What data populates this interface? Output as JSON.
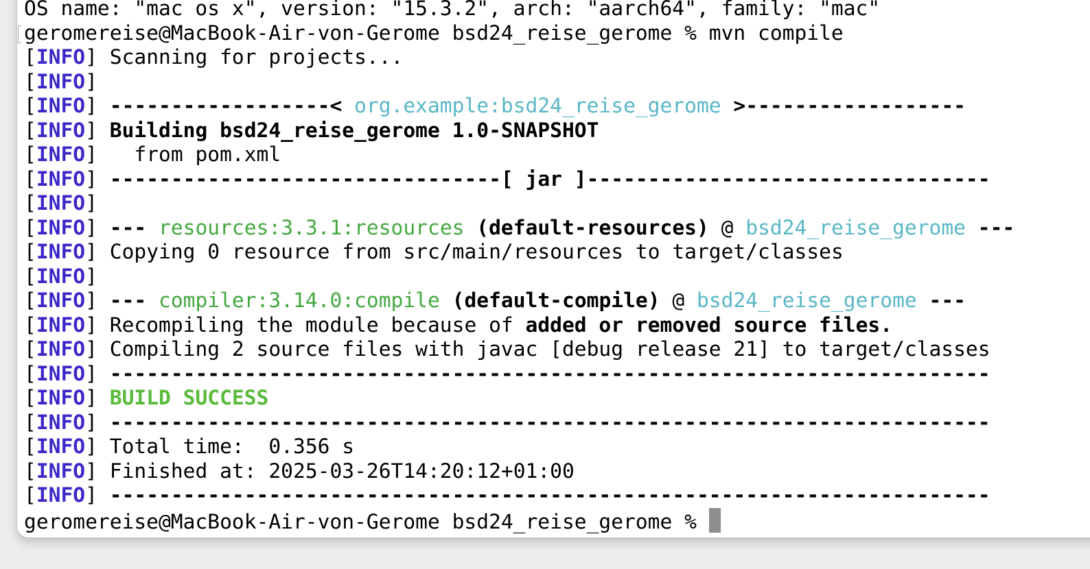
{
  "terminal": {
    "info_tag": "INFO",
    "lines": {
      "os_info": "OS name: \"mac os x\", version: \"15.3.2\", arch: \"aarch64\", family: \"mac\"",
      "prompt1": "geromereise@MacBook-Air-von-Gerome bsd24_reise_gerome % mvn compile",
      "scanning": "Scanning for projects...",
      "artifact_left": "------------------< ",
      "artifact": "org.example:bsd24_reise_gerome",
      "artifact_right": " >------------------",
      "building": "Building bsd24_reise_gerome 1.0-SNAPSHOT",
      "from_pom": "  from pom.xml",
      "jar_sep": "--------------------------------[ jar ]---------------------------------",
      "res_dashes": "--- ",
      "res_plugin": "resources:3.3.1:resources",
      "res_exec": " (default-resources)",
      "res_at": " @ ",
      "res_project": "bsd24_reise_gerome",
      "res_end": " ---",
      "copying": "Copying 0 resource from src/main/resources to target/classes",
      "comp_dashes": "--- ",
      "comp_plugin": "compiler:3.14.0:compile",
      "comp_exec": " (default-compile)",
      "comp_at": " @ ",
      "comp_project": "bsd24_reise_gerome",
      "comp_end": " ---",
      "recompiling_pre": "Recompiling the module because of ",
      "recompiling_bold": "added or removed source files.",
      "compiling": "Compiling 2 source files with javac [debug release 21] to target/classes",
      "separator": "------------------------------------------------------------------------",
      "build_success": "BUILD SUCCESS",
      "total_time": "Total time:  0.356 s",
      "finished_at": "Finished at: 2025-03-26T14:20:12+01:00",
      "prompt2": "geromereise@MacBook-Air-von-Gerome bsd24_reise_gerome % "
    }
  },
  "colors": {
    "info_tag": "#3b27c8",
    "cyan": "#58b7c6",
    "green": "#43a83f",
    "success": "#5aba3b",
    "cursor": "#8e8e8e"
  }
}
